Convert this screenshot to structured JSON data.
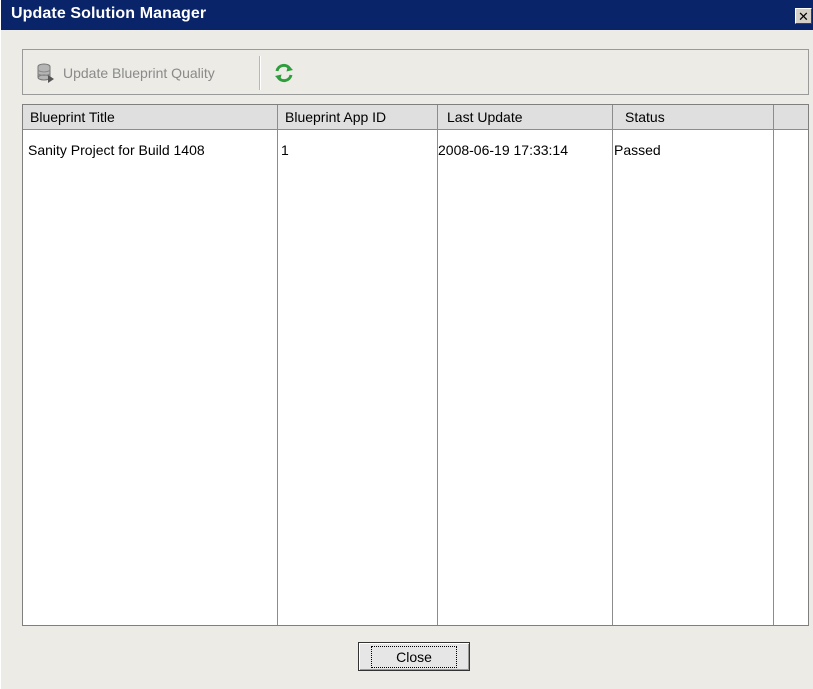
{
  "window": {
    "title": "Update Solution Manager",
    "close_glyph": "✕"
  },
  "toolbar": {
    "update_quality_label": "Update Blueprint Quality",
    "update_quality_icon": "database-update-icon",
    "refresh_icon": "refresh-icon"
  },
  "table": {
    "columns": [
      "Blueprint Title",
      "Blueprint App ID",
      "Last Update",
      "Status"
    ],
    "rows": [
      [
        "Sanity Project for Build 1408",
        "1",
        "2008-06-19 17:33:14",
        "Passed"
      ]
    ]
  },
  "footer": {
    "close_label": "Close"
  },
  "colors": {
    "titlebar": "#0a246a",
    "refresh_green": "#2e9e3c"
  }
}
